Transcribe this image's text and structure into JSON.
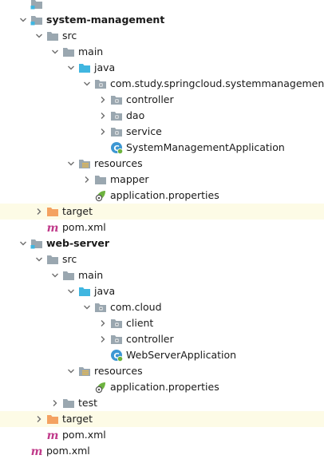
{
  "tree": [
    {
      "level": 0,
      "arrow": "none",
      "icon": "module-folder-icon",
      "label": "",
      "bold": false,
      "highlight": false
    },
    {
      "level": 0,
      "arrow": "down",
      "icon": "module-folder-icon",
      "label": "system-management",
      "bold": true,
      "highlight": false
    },
    {
      "level": 1,
      "arrow": "down",
      "icon": "folder-icon",
      "label": "src",
      "bold": false,
      "highlight": false
    },
    {
      "level": 2,
      "arrow": "down",
      "icon": "folder-icon",
      "label": "main",
      "bold": false,
      "highlight": false
    },
    {
      "level": 3,
      "arrow": "down",
      "icon": "source-folder-icon",
      "label": "java",
      "bold": false,
      "highlight": false
    },
    {
      "level": 4,
      "arrow": "down",
      "icon": "package-icon",
      "label": "com.study.springcloud.systemmanagement",
      "bold": false,
      "highlight": false
    },
    {
      "level": 5,
      "arrow": "right",
      "icon": "package-icon",
      "label": "controller",
      "bold": false,
      "highlight": false
    },
    {
      "level": 5,
      "arrow": "right",
      "icon": "package-icon",
      "label": "dao",
      "bold": false,
      "highlight": false
    },
    {
      "level": 5,
      "arrow": "right",
      "icon": "package-icon",
      "label": "service",
      "bold": false,
      "highlight": false
    },
    {
      "level": 5,
      "arrow": "none",
      "icon": "spring-class-icon",
      "label": "SystemManagementApplication",
      "bold": false,
      "highlight": false
    },
    {
      "level": 3,
      "arrow": "down",
      "icon": "resources-folder-icon",
      "label": "resources",
      "bold": false,
      "highlight": false
    },
    {
      "level": 4,
      "arrow": "right",
      "icon": "folder-icon",
      "label": "mapper",
      "bold": false,
      "highlight": false
    },
    {
      "level": 4,
      "arrow": "none",
      "icon": "properties-icon",
      "label": "application.properties",
      "bold": false,
      "highlight": false
    },
    {
      "level": 1,
      "arrow": "right",
      "icon": "target-folder-icon",
      "label": "target",
      "bold": false,
      "highlight": true
    },
    {
      "level": 1,
      "arrow": "none",
      "icon": "maven-icon",
      "label": "pom.xml",
      "bold": false,
      "highlight": false
    },
    {
      "level": 0,
      "arrow": "down",
      "icon": "module-folder-icon",
      "label": "web-server",
      "bold": true,
      "highlight": false
    },
    {
      "level": 1,
      "arrow": "down",
      "icon": "folder-icon",
      "label": "src",
      "bold": false,
      "highlight": false
    },
    {
      "level": 2,
      "arrow": "down",
      "icon": "folder-icon",
      "label": "main",
      "bold": false,
      "highlight": false
    },
    {
      "level": 3,
      "arrow": "down",
      "icon": "source-folder-icon",
      "label": "java",
      "bold": false,
      "highlight": false
    },
    {
      "level": 4,
      "arrow": "down",
      "icon": "package-icon",
      "label": "com.cloud",
      "bold": false,
      "highlight": false
    },
    {
      "level": 5,
      "arrow": "right",
      "icon": "package-icon",
      "label": "client",
      "bold": false,
      "highlight": false
    },
    {
      "level": 5,
      "arrow": "right",
      "icon": "package-icon",
      "label": "controller",
      "bold": false,
      "highlight": false
    },
    {
      "level": 5,
      "arrow": "none",
      "icon": "spring-class-icon",
      "label": "WebServerApplication",
      "bold": false,
      "highlight": false
    },
    {
      "level": 3,
      "arrow": "down",
      "icon": "resources-folder-icon",
      "label": "resources",
      "bold": false,
      "highlight": false
    },
    {
      "level": 4,
      "arrow": "none",
      "icon": "properties-icon",
      "label": "application.properties",
      "bold": false,
      "highlight": false
    },
    {
      "level": 2,
      "arrow": "right",
      "icon": "folder-icon",
      "label": "test",
      "bold": false,
      "highlight": false
    },
    {
      "level": 1,
      "arrow": "right",
      "icon": "target-folder-icon",
      "label": "target",
      "bold": false,
      "highlight": true
    },
    {
      "level": 1,
      "arrow": "none",
      "icon": "maven-icon",
      "label": "pom.xml",
      "bold": false,
      "highlight": false
    },
    {
      "level": 0,
      "arrow": "none",
      "icon": "maven-icon",
      "label": "pom.xml",
      "bold": false,
      "highlight": false
    }
  ],
  "colors": {
    "highlight_row": "#fdfbe6",
    "folder": "#9aa7b0",
    "source_folder": "#40b6e0",
    "target_folder": "#f4a261",
    "maven": "#c03a8a",
    "spring": "#6db33f"
  }
}
